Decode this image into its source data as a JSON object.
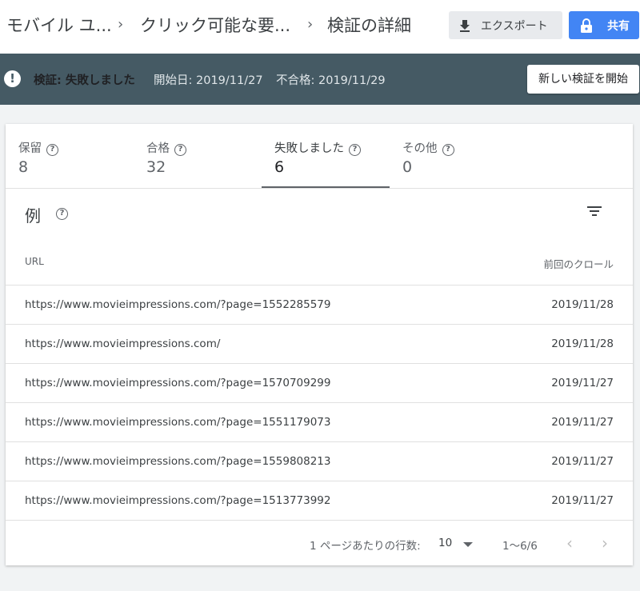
{
  "breadcrumb": {
    "items": [
      "モバイル ユ...",
      "クリック可能な要...",
      "検証の詳細"
    ]
  },
  "toolbar": {
    "export_label": "エクスポート",
    "share_label": "共有"
  },
  "validation": {
    "status_label": "検証: 失敗しました",
    "start_date": "開始日: 2019/11/27",
    "failed_date": "不合格: 2019/11/29",
    "new_button": "新しい検証を開始"
  },
  "tabs": [
    {
      "label": "保留",
      "count": "8"
    },
    {
      "label": "合格",
      "count": "32"
    },
    {
      "label": "失敗しました",
      "count": "6"
    },
    {
      "label": "その他",
      "count": "0"
    }
  ],
  "active_tab": 2,
  "examples": {
    "title": "例",
    "columns": {
      "url": "URL",
      "last_crawl": "前回のクロール"
    },
    "rows": [
      {
        "url": "https://www.movieimpressions.com/?page=1552285579",
        "date": "2019/11/28"
      },
      {
        "url": "https://www.movieimpressions.com/",
        "date": "2019/11/28"
      },
      {
        "url": "https://www.movieimpressions.com/?page=1570709299",
        "date": "2019/11/27"
      },
      {
        "url": "https://www.movieimpressions.com/?page=1551179073",
        "date": "2019/11/27"
      },
      {
        "url": "https://www.movieimpressions.com/?page=1559808213",
        "date": "2019/11/27"
      },
      {
        "url": "https://www.movieimpressions.com/?page=1513773992",
        "date": "2019/11/27"
      }
    ]
  },
  "pagination": {
    "rows_per_page_label": "1 ページあたりの行数:",
    "rows_per_page": "10",
    "range": "1～6/6"
  },
  "icons": {
    "export": "download-icon",
    "share": "lock-icon",
    "status": "error-icon",
    "help": "help-circle-icon",
    "filter": "filter-icon",
    "prev": "chevron-left-icon",
    "next": "chevron-right-icon"
  },
  "colors": {
    "validation_bar": "#455a64",
    "share_button": "#4285f4",
    "export_button": "#e8eaed"
  }
}
